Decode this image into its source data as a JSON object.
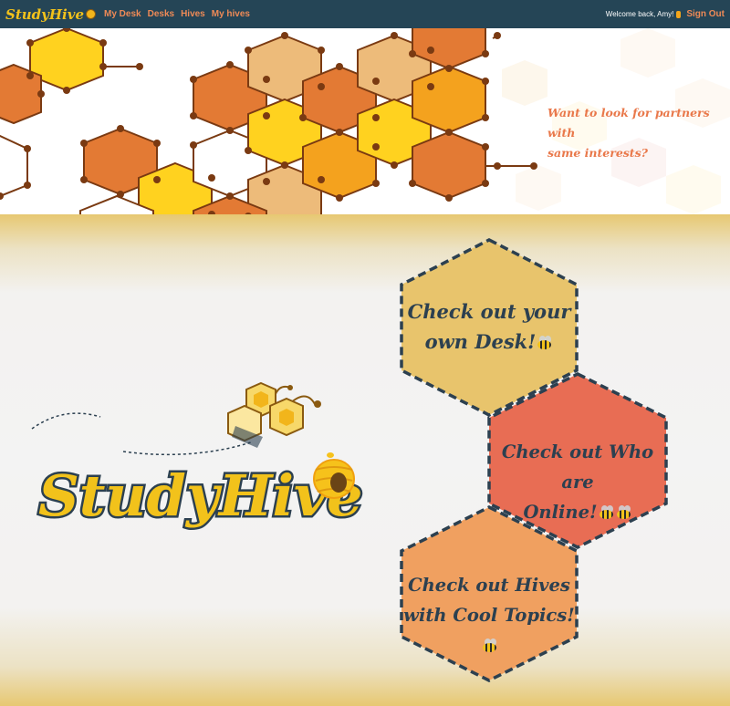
{
  "navbar": {
    "brand": "StudyHive",
    "links": [
      "My Desk",
      "Desks",
      "Hives",
      "My hives"
    ],
    "welcome": "Welcome back, Amy!",
    "signout": "Sign Out"
  },
  "banner": {
    "line1": "Want to look for partners with",
    "line2": "same interests?"
  },
  "logo": {
    "text": "StudyHive"
  },
  "cards": {
    "desk": {
      "line1": "Check out your",
      "line2": "own Desk!"
    },
    "online": {
      "line1": "Check out Who are",
      "line2": "Online!"
    },
    "hives": {
      "line1": "Check out Hives",
      "line2": "with Cool Topics!"
    }
  },
  "colors": {
    "navbar_bg": "#254556",
    "nav_link": "#ef8a56",
    "card_desk": "#e8c46c",
    "card_online": "#e86d54",
    "card_hives": "#f0a060",
    "card_border": "#2c4050"
  }
}
